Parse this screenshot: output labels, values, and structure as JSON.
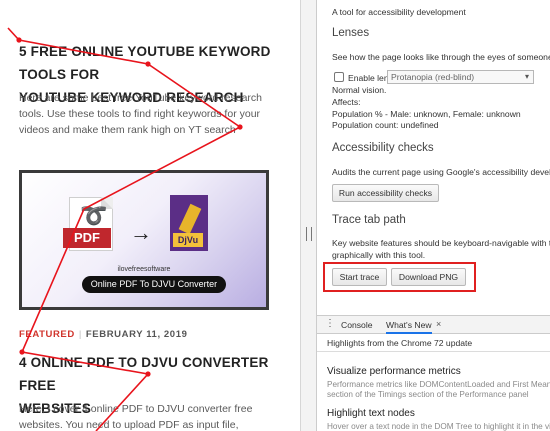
{
  "page": {
    "post1": {
      "title_line1": "5 Free Online YouTube Keyword Tools For",
      "title_line2": "YouTube Keyword Research",
      "excerpt_line1": "Here are some best free YouTube keyword research",
      "excerpt_line2": "tools. Use these tools to find right keywords for your",
      "excerpt_line3": "videos and make them rank high on YT search"
    },
    "thumbnail": {
      "pdf_label": "PDF",
      "djvu_label": "DjVu",
      "brand_text": "ilovefreesoftware",
      "pill_text": "Online PDF To DJVU Converter"
    },
    "post2": {
      "category": "FEATURED",
      "separator": "|",
      "date": "FEBRUARY 11, 2019",
      "title_line1": "4 Online PDF To DJVU Converter Free",
      "title_line2": "Websites",
      "excerpt_line1": "Here, I cover 4 online PDF to DJVU converter free",
      "excerpt_line2": "websites. You need to upload PDF as input file, choose"
    },
    "colors": {
      "trace": "#e8141c",
      "accent_red": "#d0342c",
      "highlight": "#e02020"
    }
  },
  "devtools": {
    "intro": "A tool for accessibility development",
    "lenses": {
      "heading": "Lenses",
      "desc": "See how the page looks like through the eyes of someone",
      "enable_label": "Enable lens",
      "select_value": "Protanopia (red-blind)",
      "vision": "Normal vision.",
      "affects": "Affects:",
      "population_pct": "Population % - Male: unknown, Female: unknown",
      "population_count": "Population count: undefined"
    },
    "checks": {
      "heading": "Accessibility checks",
      "desc": "Audits the current page using Google's accessibility developer tools",
      "run_button": "Run accessibility checks"
    },
    "trace": {
      "heading": "Trace tab path",
      "desc_line1": "Key website features should be keyboard-navigable with the tab key",
      "desc_line2": "graphically with this tool.",
      "start_button": "Start trace",
      "download_button": "Download PNG"
    },
    "drawer": {
      "menu_icon": "kebab-menu-icon",
      "tabs": [
        {
          "label": "Console"
        },
        {
          "label": "What's New"
        }
      ],
      "close_glyph": "×",
      "subhead": "Highlights from the Chrome 72 update",
      "items": [
        {
          "title": "Visualize performance metrics",
          "desc_line1": "Performance metrics like DOMContentLoaded and First Meaningful",
          "desc_line2": "section of the Timings section of the Performance panel"
        },
        {
          "title": "Highlight text nodes",
          "desc_line1": "Hover over a text node in the DOM Tree to highlight it in the viewport"
        }
      ]
    }
  }
}
